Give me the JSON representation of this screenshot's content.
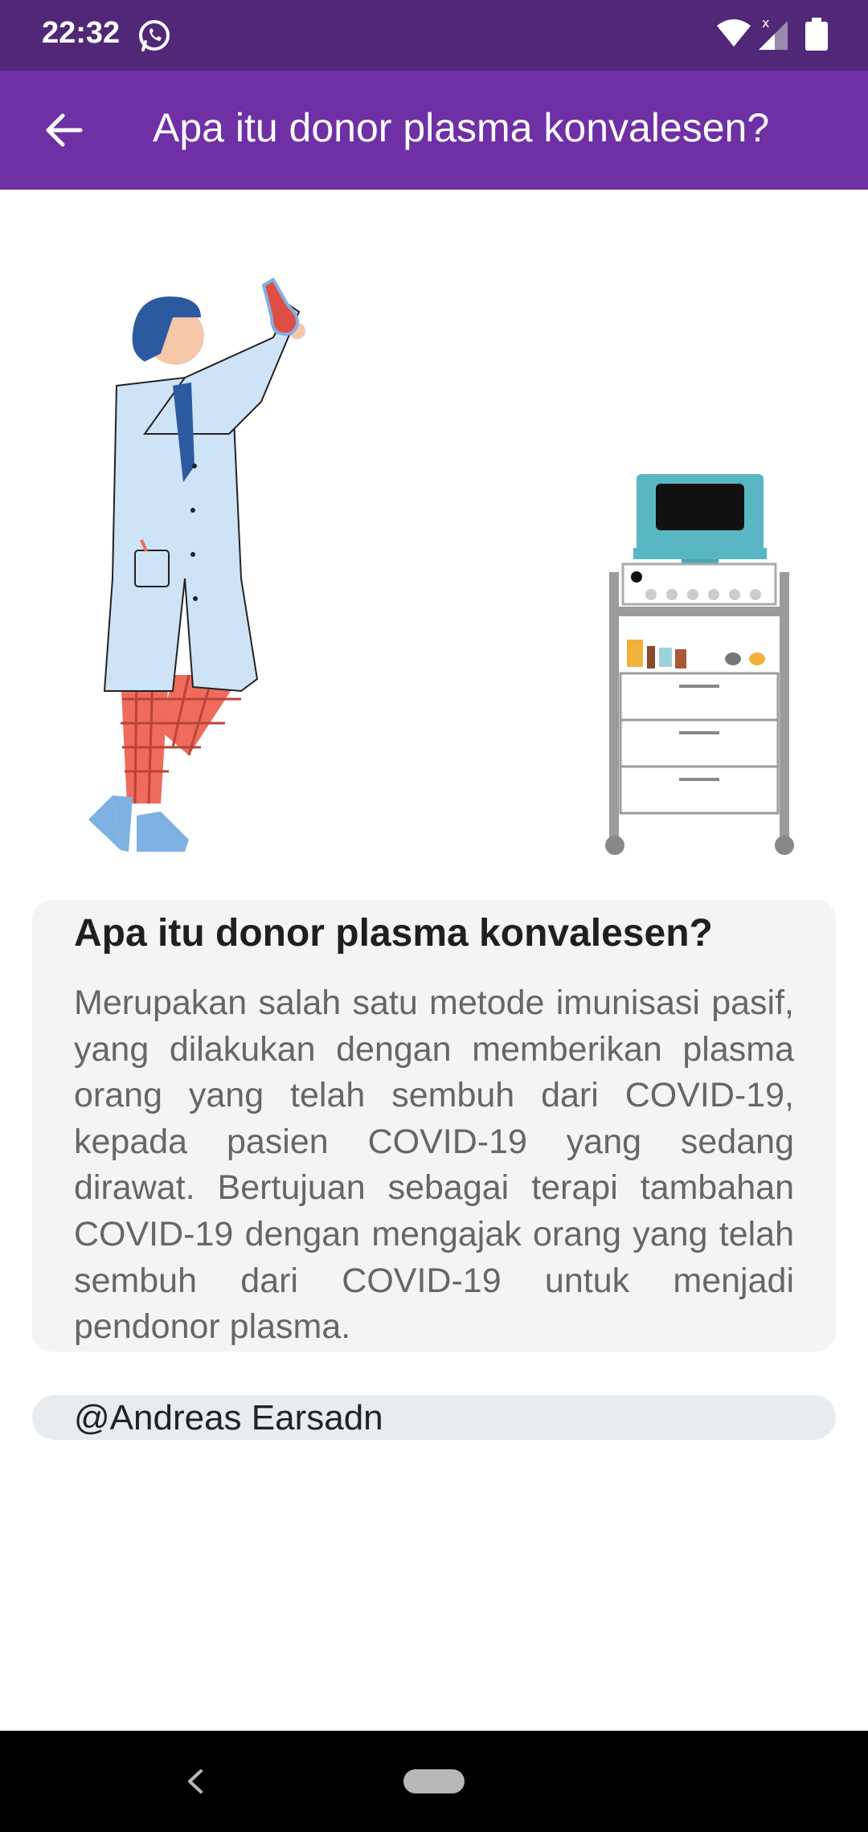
{
  "status_bar": {
    "time": "22:32",
    "background": "#512878",
    "icons": [
      "whatsapp-icon",
      "wifi-icon",
      "signal-icon",
      "battery-icon"
    ]
  },
  "app_bar": {
    "title": "Apa itu donor plasma konvalesen?",
    "background": "#6f2fa5",
    "back_icon": "arrow-left-icon"
  },
  "illustration": {
    "subjects": [
      "scientist-illustration",
      "medical-cart-illustration"
    ]
  },
  "card": {
    "title": "Apa itu donor plasma konvalesen?",
    "body": "Merupakan salah satu metode imunisasi pasif, yang dilakukan dengan memberikan plasma orang yang telah sembuh dari COVID-19, kepada pasien COVID-19 yang sedang dirawat. Bertujuan sebagai terapi tambahan COVID-19 dengan mengajak orang yang telah sembuh dari COVID-19 untuk menjadi pendonor plasma."
  },
  "credit": {
    "text": "@Andreas Earsadn"
  },
  "nav_bar": {
    "icons": [
      "nav-back-icon",
      "nav-home-pill"
    ]
  }
}
